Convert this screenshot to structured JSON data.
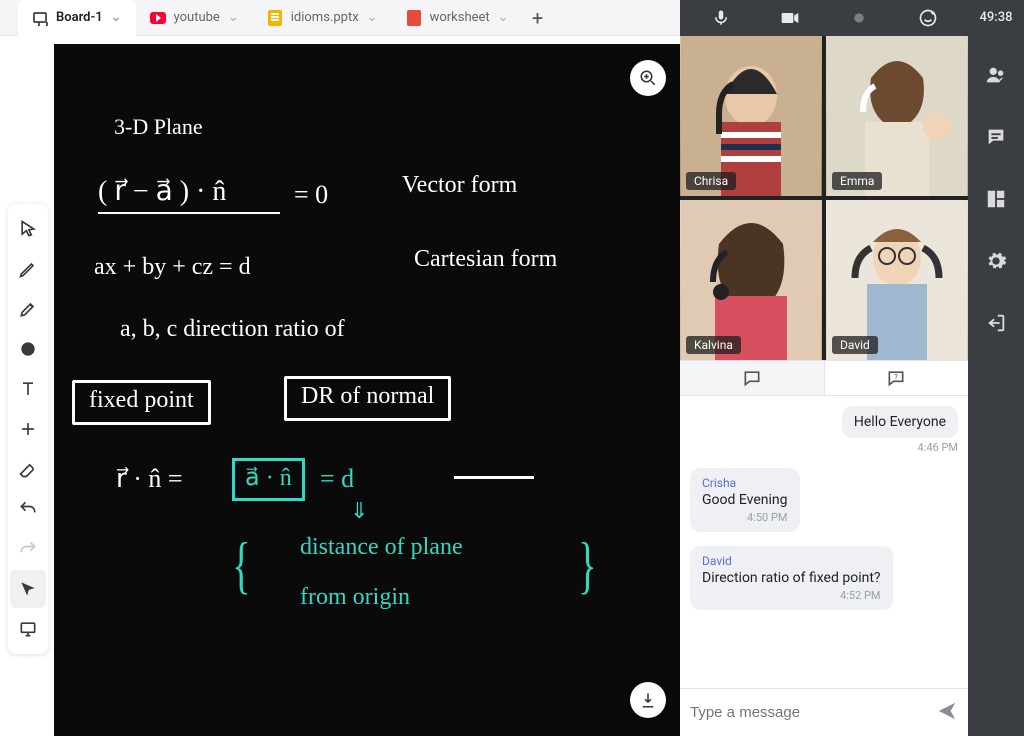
{
  "tabs": [
    {
      "label": "Board-1",
      "kind": "board"
    },
    {
      "label": "youtube",
      "kind": "youtube"
    },
    {
      "label": "idioms.pptx",
      "kind": "slides"
    },
    {
      "label": "worksheet",
      "kind": "pdf"
    }
  ],
  "timer": "49:38",
  "board": {
    "title": "3-D   Plane",
    "line_vector_lhs": "( r⃗ − a⃗ ) · n̂",
    "line_vector_eq": "=   0",
    "line_vector_label": "Vector  form",
    "line_cart_lhs": "ax  + by  + cz  =  d",
    "line_cart_label": "Cartesian  form",
    "line_dr": "a, b, c   direction   ratio   of",
    "box_fixed": "fixed  point",
    "box_dr": "DR   of   normal",
    "line_teal_lhs": "r⃗ · n̂   =",
    "tealbox": "a⃗ · n̂",
    "line_teal_rhs": "= d",
    "arrow_down": "⇓",
    "brace_open": "{",
    "teal_text1": "distance  of  plane",
    "teal_text2": "from  origin",
    "brace_close": "}"
  },
  "participants": [
    {
      "name": "Chrisa"
    },
    {
      "name": "Emma"
    },
    {
      "name": "Kalvina"
    },
    {
      "name": "David"
    }
  ],
  "chat": {
    "messages": [
      {
        "sender": null,
        "text": "Hello Everyone",
        "time": "4:46 PM",
        "mine": true
      },
      {
        "sender": "Crisha",
        "text": "Good Evening",
        "time": "4:50 PM",
        "mine": false
      },
      {
        "sender": "David",
        "text": "Direction ratio of fixed point?",
        "time": "4:52 PM",
        "mine": false
      }
    ],
    "placeholder": "Type a message"
  },
  "icons": {
    "chev": "⌄"
  }
}
